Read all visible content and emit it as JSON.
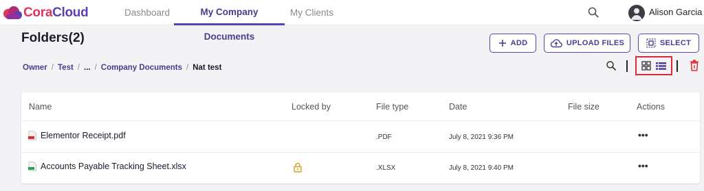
{
  "app": {
    "logo_part1": "Cora",
    "logo_part2": "Cloud"
  },
  "nav": {
    "tabs": [
      "Dashboard",
      "My Company Documents",
      "My Clients"
    ],
    "active": "My Company Documents"
  },
  "user": {
    "name": "Alison Garcia"
  },
  "page": {
    "title": "Folders(2)"
  },
  "actions": {
    "add_label": "ADD",
    "upload_label": "UPLOAD FILES",
    "select_label": "SELECT"
  },
  "breadcrumb": [
    "Owner",
    "Test",
    "...",
    "Company Documents",
    "Nat test"
  ],
  "table": {
    "columns": [
      "Name",
      "Locked by",
      "File type",
      "Date",
      "File size",
      "Actions"
    ],
    "rows": [
      {
        "name": "Elementor Receipt.pdf",
        "locked": false,
        "type": ".PDF",
        "date": "July 8, 2021 9:36 PM",
        "size": "",
        "actions": "•••"
      },
      {
        "name": "Accounts Payable Tracking Sheet.xlsx",
        "locked": true,
        "type": ".XLSX",
        "date": "July 8, 2021 9:40 PM",
        "size": "",
        "actions": "•••"
      }
    ]
  },
  "colors": {
    "brand_purple": "#5b3fb3",
    "brand_red": "#e2355c",
    "highlight_red": "#e0282f",
    "lock_gold": "#d4a017"
  }
}
